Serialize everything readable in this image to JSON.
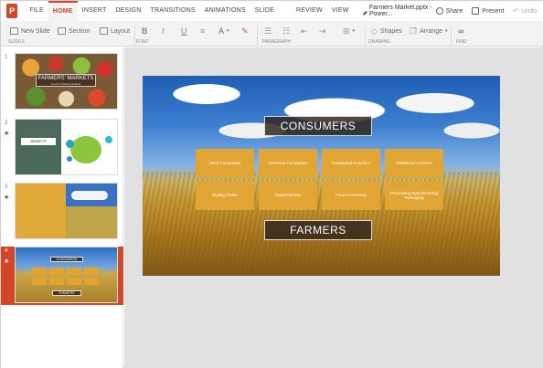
{
  "app": {
    "logo_letter": "P"
  },
  "tabs": [
    "FILE",
    "HOME",
    "INSERT",
    "DESIGN",
    "TRANSITIONS",
    "ANIMATIONS",
    "SLIDE SHOW",
    "REVIEW",
    "VIEW"
  ],
  "active_tab": "HOME",
  "document": {
    "title": "Farmers Market.pptx - Power..."
  },
  "actions": {
    "share": "Share",
    "present": "Present",
    "undo": "Undo"
  },
  "ribbon": {
    "new_slide": "New Slide",
    "section": "Section",
    "layout": "Layout",
    "font_bold": "B",
    "font_italic": "I",
    "font_underline": "U",
    "font_color": "A",
    "shapes": "Shapes",
    "arrange": "Arrange",
    "groups": [
      "SLIDES",
      "FONT",
      "PARAGRAPH",
      "DRAWING",
      "FIND"
    ]
  },
  "thumbnails": [
    {
      "num": "1",
      "star": "",
      "title": "FARMERS' MARKETS",
      "subtitle": "Fresh & Natural Markets"
    },
    {
      "num": "2",
      "star": "★",
      "label": "BENEFITS"
    },
    {
      "num": "3",
      "star": "★"
    },
    {
      "num": "4",
      "star": "★",
      "title": "CONSUMERS",
      "footer": "FARMERS"
    }
  ],
  "slide": {
    "title": "CONSUMERS",
    "footer": "FARMERS",
    "grid": [
      [
        "Seed Companies",
        "Chemical Companies",
        "Compound Suppliers",
        "Distribution Centers"
      ],
      [
        "Boxing Clerks",
        "Supermarkets",
        "Food Processing",
        "Processing Manufacturing Packaging"
      ]
    ]
  },
  "colors": {
    "accent": "#d24726",
    "box": "#e1a533"
  }
}
